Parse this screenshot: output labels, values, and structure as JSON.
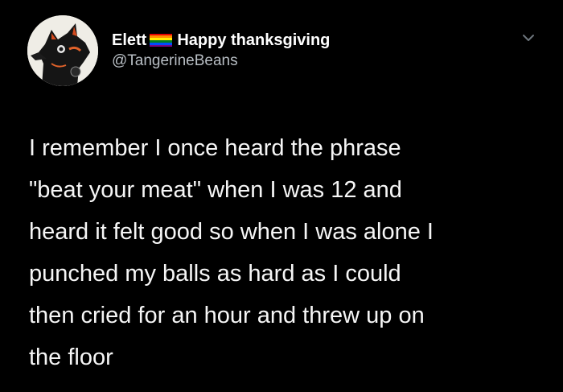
{
  "tweet": {
    "display_name_prefix": "Elett",
    "display_name_suffix": "Happy thanksgiving",
    "handle": "@TangerineBeans",
    "flag_colors": [
      "#e40303",
      "#ff8c00",
      "#ffed00",
      "#008026",
      "#004dff",
      "#750787"
    ],
    "lines": [
      "I remember I once heard the phrase",
      "\"beat your meat\" when I was 12 and",
      "heard it felt good so when I was alone I",
      "punched my balls as hard as I could",
      "then cried for an hour and threw up on",
      "the floor"
    ]
  },
  "icons": {
    "avatar": "furry-avatar-icon",
    "flag": "pride-flag-icon",
    "menu": "chevron-down-icon"
  },
  "colors": {
    "background": "#000000",
    "text": "#f6f6f6",
    "handle": "#b8bec4"
  }
}
